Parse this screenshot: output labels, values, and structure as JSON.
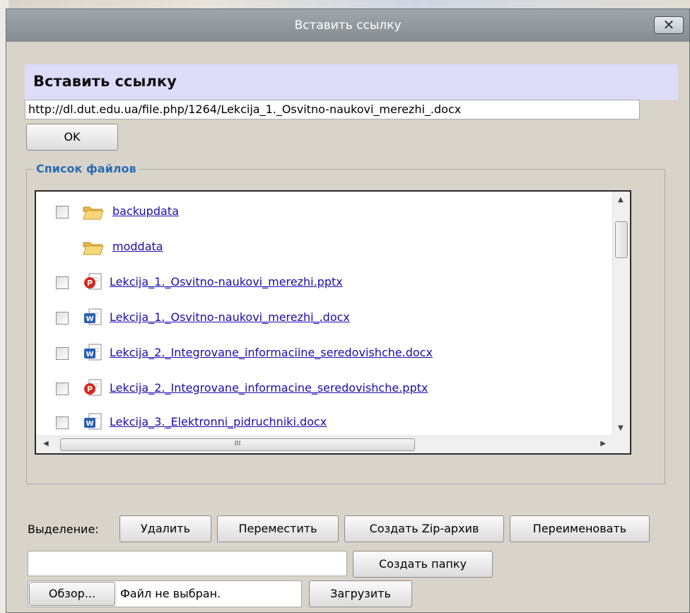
{
  "dialog": {
    "title": "Вставить ссылку",
    "close_label": "✕"
  },
  "insert_link": {
    "heading": "Вставить ссылку",
    "url_value": "http://dl.dut.edu.ua/file.php/1264/Lekcija_1._Osvitno-naukovi_merezhi_.docx",
    "ok_label": "OK"
  },
  "file_list": {
    "legend": "Список файлов",
    "items": [
      {
        "name": "backupdata",
        "type": "folder",
        "checkbox": true
      },
      {
        "name": "moddata",
        "type": "folder",
        "checkbox": false
      },
      {
        "name": "Lekcija_1._Osvitno-naukovi_merezhi.pptx",
        "type": "pptx",
        "checkbox": true
      },
      {
        "name": "Lekcija_1._Osvitno-naukovi_merezhi_.docx",
        "type": "docx",
        "checkbox": true
      },
      {
        "name": "Lekcija_2._Integrovane_informaciine_seredovishche.docx",
        "type": "docx",
        "checkbox": true
      },
      {
        "name": "Lekcija_2._Integrovane_informacine_seredovishche.pptx",
        "type": "pptx",
        "checkbox": true
      },
      {
        "name": "Lekcija_3._Elektronni_pidruchniki.docx",
        "type": "docx",
        "checkbox": true
      }
    ],
    "hscroll_grip": "III"
  },
  "actions": {
    "selection_label": "Выделение:",
    "delete_label": "Удалить",
    "move_label": "Переместить",
    "zip_label": "Создать Zip-архив",
    "rename_label": "Переименовать",
    "folder_name_value": "",
    "create_folder_label": "Создать папку",
    "browse_label": "Обзор...",
    "no_file_label": "Файл не выбран.",
    "upload_label": "Загрузить"
  },
  "colors": {
    "heading_bg": "#ddddfa",
    "legend": "#2a6db0",
    "link": "#1a0dab",
    "titlebar": "#8f969c"
  }
}
